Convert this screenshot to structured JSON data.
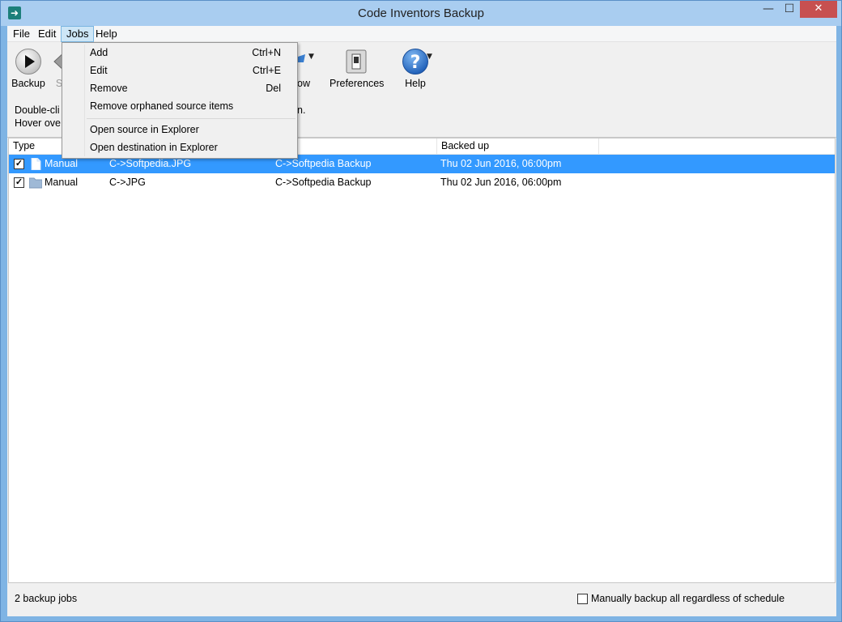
{
  "window": {
    "title": "Code Inventors Backup"
  },
  "menubar": {
    "items": [
      "File",
      "Edit",
      "Jobs",
      "Help"
    ]
  },
  "toolbar": {
    "backup_label": "Backup",
    "partial_label_s": "S",
    "partial_label_ow": "ow",
    "preferences_label": "Preferences",
    "help_label": "Help"
  },
  "hints": {
    "line1": "Double-cli",
    "line2": "Hover ove",
    "line1_end": "n."
  },
  "table": {
    "columns": [
      "Type",
      "",
      "",
      "Backed up"
    ],
    "rows": [
      {
        "checked": true,
        "icon": "file-icon",
        "type": "Manual",
        "source": "C->Softpedia.JPG",
        "destination": "C->Softpedia Backup",
        "backed_up": "Thu 02 Jun 2016, 06:00pm",
        "selected": true
      },
      {
        "checked": true,
        "icon": "folder-icon",
        "type": "Manual",
        "source": "C->JPG",
        "destination": "C->Softpedia Backup",
        "backed_up": "Thu 02 Jun 2016, 06:00pm",
        "selected": false
      }
    ]
  },
  "status": {
    "text": "2 backup jobs",
    "manual_checkbox_label": "Manually backup all regardless of schedule",
    "manual_checkbox_checked": false
  },
  "jobs_menu": {
    "items": [
      {
        "label": "Add",
        "shortcut": "Ctrl+N"
      },
      {
        "label": "Edit",
        "shortcut": "Ctrl+E"
      },
      {
        "label": "Remove",
        "shortcut": "Del"
      },
      {
        "label": "Remove orphaned source items",
        "shortcut": ""
      },
      {
        "label": "Open source in Explorer",
        "shortcut": ""
      },
      {
        "label": "Open destination in Explorer",
        "shortcut": ""
      }
    ]
  },
  "colors": {
    "selection": "#3399ff",
    "titlebar": "#a9cdf0",
    "close_button": "#c75050",
    "help_icon": "#2a6fc9"
  }
}
